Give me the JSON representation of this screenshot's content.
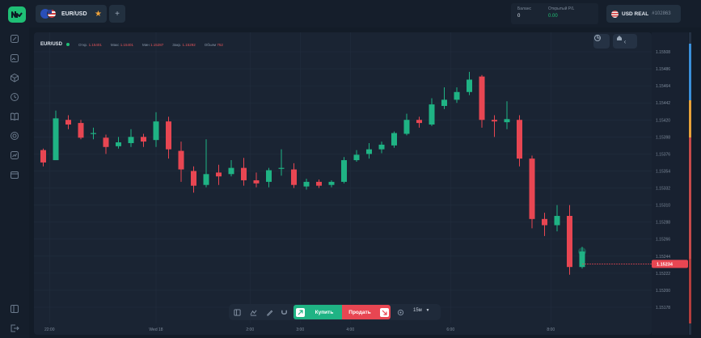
{
  "header": {
    "pair": "EUR/USD",
    "add_tab": "+",
    "balance_label": "Баланс",
    "balance_value": "0",
    "pnl_label": "Открытый P/L",
    "pnl_value": "0.00",
    "account_name": "USD REAL",
    "account_id": "#102863"
  },
  "ohlc": {
    "symbol": "EUR/USD",
    "open_label": "Откр.",
    "open_value": "1.15401",
    "high_label": "Макс",
    "high_value": "1.15401",
    "low_label": "Мин",
    "low_value": "1.15287",
    "close_label": "Закр.",
    "close_value": "1.15292",
    "volume_label": "Объем",
    "volume_value": "752"
  },
  "toolbar": {
    "buy_label": "Купить",
    "sell_label": "Продать",
    "timeframe": "15м"
  },
  "colors": {
    "up": "#1fb384",
    "down": "#e84652",
    "grid": "#222e3e",
    "accent": "#1fbf75"
  },
  "chart_data": {
    "type": "candlestick",
    "x_ticks": [
      {
        "label": "22:00",
        "i": 0.5
      },
      {
        "label": "Wed 18",
        "i": 9
      },
      {
        "label": "2:00",
        "i": 16.5
      },
      {
        "label": "3:00",
        "i": 20.5
      },
      {
        "label": "4:00",
        "i": 24.5
      },
      {
        "label": "6:00",
        "i": 32.5
      },
      {
        "label": "8:00",
        "i": 40.5
      }
    ],
    "y_ticks": [
      "1.15508",
      "1.15486",
      "1.15464",
      "1.15442",
      "1.15420",
      "1.15398",
      "1.15376",
      "1.15354",
      "1.15332",
      "1.15310",
      "1.15288",
      "1.15266",
      "1.15244",
      "1.15222",
      "1.15200",
      "1.15178"
    ],
    "ylim": [
      1.15178,
      1.15508
    ],
    "current_price": "1.15234",
    "candles": [
      {
        "o": 1.15381,
        "h": 1.15383,
        "l": 1.1536,
        "c": 1.15365
      },
      {
        "o": 1.15368,
        "h": 1.15432,
        "l": 1.15368,
        "c": 1.15422
      },
      {
        "o": 1.1542,
        "h": 1.15426,
        "l": 1.15408,
        "c": 1.15414
      },
      {
        "o": 1.15416,
        "h": 1.1542,
        "l": 1.15395,
        "c": 1.15397
      },
      {
        "o": 1.15402,
        "h": 1.1541,
        "l": 1.15395,
        "c": 1.15403
      },
      {
        "o": 1.15397,
        "h": 1.15401,
        "l": 1.15376,
        "c": 1.15385
      },
      {
        "o": 1.15386,
        "h": 1.15398,
        "l": 1.15383,
        "c": 1.15391
      },
      {
        "o": 1.1539,
        "h": 1.15408,
        "l": 1.15385,
        "c": 1.15398
      },
      {
        "o": 1.15398,
        "h": 1.15402,
        "l": 1.15385,
        "c": 1.15392
      },
      {
        "o": 1.15394,
        "h": 1.1543,
        "l": 1.15385,
        "c": 1.15418
      },
      {
        "o": 1.15418,
        "h": 1.15424,
        "l": 1.1537,
        "c": 1.15382
      },
      {
        "o": 1.1538,
        "h": 1.15392,
        "l": 1.1534,
        "c": 1.15356
      },
      {
        "o": 1.15354,
        "h": 1.1536,
        "l": 1.15326,
        "c": 1.15335
      },
      {
        "o": 1.15336,
        "h": 1.15395,
        "l": 1.15333,
        "c": 1.1535
      },
      {
        "o": 1.15352,
        "h": 1.15362,
        "l": 1.15336,
        "c": 1.15347
      },
      {
        "o": 1.1535,
        "h": 1.15368,
        "l": 1.15347,
        "c": 1.15358
      },
      {
        "o": 1.15358,
        "h": 1.15371,
        "l": 1.15335,
        "c": 1.15342
      },
      {
        "o": 1.15342,
        "h": 1.15352,
        "l": 1.15333,
        "c": 1.15338
      },
      {
        "o": 1.1534,
        "h": 1.15358,
        "l": 1.15333,
        "c": 1.15355
      },
      {
        "o": 1.15358,
        "h": 1.15382,
        "l": 1.15348,
        "c": 1.15358
      },
      {
        "o": 1.15356,
        "h": 1.15364,
        "l": 1.15332,
        "c": 1.15336
      },
      {
        "o": 1.15334,
        "h": 1.15344,
        "l": 1.1533,
        "c": 1.1534
      },
      {
        "o": 1.1534,
        "h": 1.15343,
        "l": 1.15332,
        "c": 1.15335
      },
      {
        "o": 1.15336,
        "h": 1.15342,
        "l": 1.15333,
        "c": 1.1534
      },
      {
        "o": 1.1534,
        "h": 1.15372,
        "l": 1.15338,
        "c": 1.15368
      },
      {
        "o": 1.15368,
        "h": 1.15381,
        "l": 1.15366,
        "c": 1.15375
      },
      {
        "o": 1.15376,
        "h": 1.1539,
        "l": 1.1537,
        "c": 1.15382
      },
      {
        "o": 1.15382,
        "h": 1.15392,
        "l": 1.15377,
        "c": 1.15388
      },
      {
        "o": 1.15387,
        "h": 1.15405,
        "l": 1.15384,
        "c": 1.15403
      },
      {
        "o": 1.15402,
        "h": 1.15428,
        "l": 1.154,
        "c": 1.1542
      },
      {
        "o": 1.1542,
        "h": 1.15424,
        "l": 1.1541,
        "c": 1.15416
      },
      {
        "o": 1.15414,
        "h": 1.15448,
        "l": 1.15412,
        "c": 1.1544
      },
      {
        "o": 1.15438,
        "h": 1.15462,
        "l": 1.15434,
        "c": 1.15446
      },
      {
        "o": 1.15446,
        "h": 1.15462,
        "l": 1.15442,
        "c": 1.15456
      },
      {
        "o": 1.15456,
        "h": 1.15482,
        "l": 1.15452,
        "c": 1.15472
      },
      {
        "o": 1.15476,
        "h": 1.15478,
        "l": 1.1541,
        "c": 1.1542
      },
      {
        "o": 1.1542,
        "h": 1.15426,
        "l": 1.15398,
        "c": 1.15418
      },
      {
        "o": 1.15417,
        "h": 1.15444,
        "l": 1.15408,
        "c": 1.15421
      },
      {
        "o": 1.1542,
        "h": 1.15426,
        "l": 1.1536,
        "c": 1.1537
      },
      {
        "o": 1.1537,
        "h": 1.15374,
        "l": 1.1528,
        "c": 1.15292
      },
      {
        "o": 1.15292,
        "h": 1.153,
        "l": 1.1527,
        "c": 1.15284
      },
      {
        "o": 1.15284,
        "h": 1.1531,
        "l": 1.15276,
        "c": 1.15296
      },
      {
        "o": 1.15296,
        "h": 1.1531,
        "l": 1.1522,
        "c": 1.1523
      },
      {
        "o": 1.1523,
        "h": 1.15256,
        "l": 1.15228,
        "c": 1.1525
      }
    ]
  }
}
